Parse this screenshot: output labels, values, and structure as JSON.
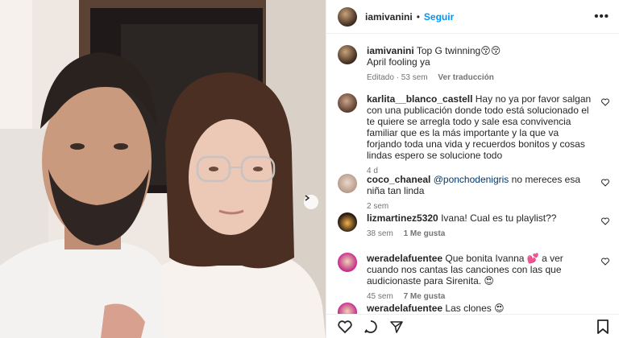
{
  "post": {
    "author": "iamivanini",
    "follow_label": "Seguir",
    "dot": "•",
    "more": "•••",
    "caption_line1": "Top G twinning😚😚",
    "caption_line2": "April fooling ya",
    "caption_meta_time": "Editado · 53 sem",
    "caption_meta_translate": "Ver traducción"
  },
  "comments": [
    {
      "user": "karlita__blanco_castell",
      "text": "Hay no ya por favor salgan con una publicación donde todo está solucionado el te quiere se arregla todo y sale esa convivencia familiar que es la más importante y la que va forjando toda una vida y recuerdos bonitos y cosas lindas espero se solucione todo",
      "time": "4 d",
      "likes": ""
    },
    {
      "user": "coco_chaneal",
      "mention": "@ponchodenigris",
      "text": "no mereces esa niña tan linda",
      "time": "2 sem",
      "likes": ""
    },
    {
      "user": "lizmartinez5320",
      "text": "Ivana! Cual es tu playlist??",
      "time": "38 sem",
      "likes": "1 Me gusta"
    },
    {
      "user": "weradelafuentee",
      "text": "Que bonita Ivanna 💕 a ver cuando nos cantas las canciones con las que audicionaste para Sirenita. 😍",
      "time": "45 sem",
      "likes": "7 Me gusta"
    },
    {
      "user": "weradelafuentee",
      "text": "Las clones 😍",
      "time": "",
      "likes": ""
    }
  ],
  "icons": {
    "like": "heart-icon",
    "comment": "comment-icon",
    "share": "share-icon",
    "save": "bookmark-icon",
    "next": "chevron-right-icon"
  },
  "colors": {
    "link": "#0095f6",
    "meta": "#737373",
    "text": "#262626"
  }
}
